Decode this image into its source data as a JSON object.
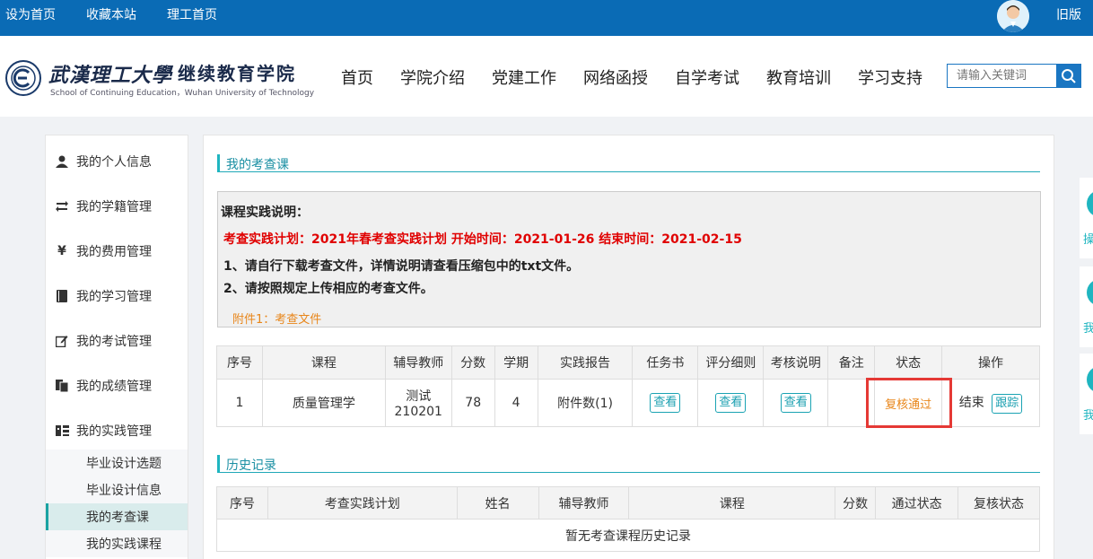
{
  "topbar": {
    "links": [
      "设为首页",
      "收藏本站",
      "理工首页"
    ],
    "old_version": "旧版"
  },
  "header": {
    "title_cn_1": "武漢理工大學",
    "title_cn_2": "继续教育学院",
    "title_en": "School of Continuing Education，Wuhan University of Technology",
    "nav": [
      "首页",
      "学院介绍",
      "党建工作",
      "网络函授",
      "自学考试",
      "教育培训",
      "学习支持"
    ],
    "search_placeholder": "请输入关键词"
  },
  "sidebar": {
    "items": [
      {
        "label": "我的个人信息",
        "icon": "user-icon"
      },
      {
        "label": "我的学籍管理",
        "icon": "swap-icon"
      },
      {
        "label": "我的费用管理",
        "icon": "yen-icon"
      },
      {
        "label": "我的学习管理",
        "icon": "book-icon"
      },
      {
        "label": "我的考试管理",
        "icon": "edit-icon"
      },
      {
        "label": "我的成绩管理",
        "icon": "document-icon"
      },
      {
        "label": "我的实践管理",
        "icon": "practice-icon"
      }
    ],
    "sub_items": [
      "毕业设计选题",
      "毕业设计信息",
      "我的考查课",
      "我的实践课程"
    ],
    "active_sub": "我的考查课"
  },
  "main": {
    "section1_title": "我的考查课",
    "notice": {
      "heading": "课程实践说明：",
      "plan_line": "考查实践计划：2021年春考查实践计划  开始时间：2021-01-26  结束时间：2021-02-15",
      "rule1": "1、请自行下载考查文件，详情说明请查看压缩包中的txt文件。",
      "rule2": "2、请按照规定上传相应的考查文件。",
      "attachment": "附件1：考查文件"
    },
    "table1": {
      "headers": [
        "序号",
        "课程",
        "辅导教师",
        "分数",
        "学期",
        "实践报告",
        "任务书",
        "评分细则",
        "考核说明",
        "备注",
        "状态",
        "操作"
      ],
      "row": {
        "index": "1",
        "course": "质量管理学",
        "teacher_1": "测试",
        "teacher_2": "210201",
        "score": "78",
        "term": "4",
        "report": "附件数(1)",
        "view_label": "查看",
        "remark": "",
        "status": "复核通过",
        "action_text": "结束",
        "action_btn": "跟踪"
      }
    },
    "section2_title": "历史记录",
    "table2": {
      "headers": [
        "序号",
        "考查实践计划",
        "姓名",
        "辅导教师",
        "课程",
        "分数",
        "通过状态",
        "复核状态"
      ],
      "empty": "暂无考查课程历史记录"
    }
  },
  "float_cards": [
    "操",
    "我",
    "我"
  ],
  "colors": {
    "topbar": "#0a6bb5",
    "accent": "#1fb5c0",
    "alert": "#e00000",
    "status": "#e8861a",
    "highlight": "#e53935"
  }
}
